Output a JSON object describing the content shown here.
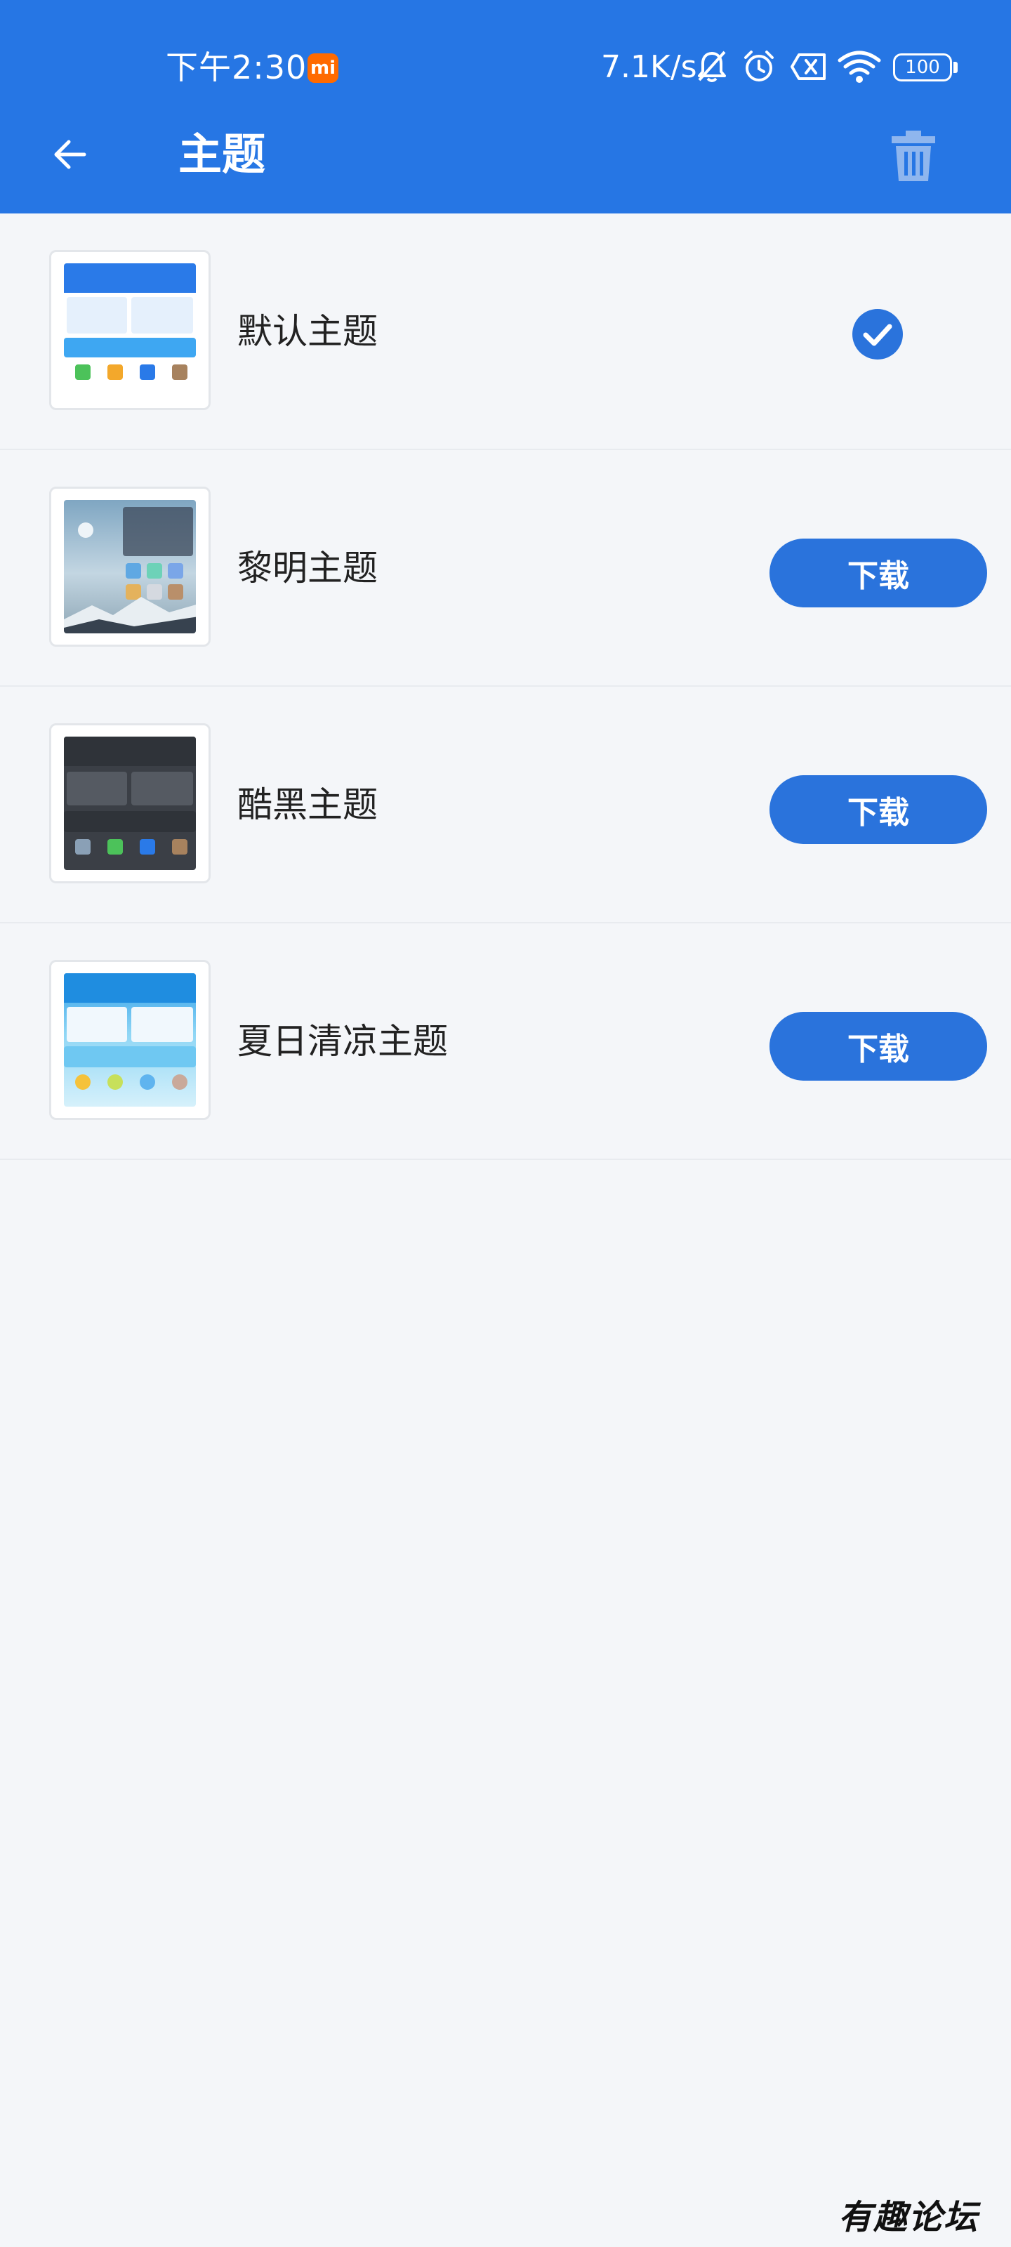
{
  "status_bar": {
    "time": "下午2:30",
    "mi_badge": "mi",
    "net_speed": "7.1K/s",
    "battery": "100"
  },
  "header": {
    "title": "主题"
  },
  "themes": [
    {
      "name": "默认主题",
      "state": "selected"
    },
    {
      "name": "黎明主题",
      "action": "下载"
    },
    {
      "name": "酷黑主题",
      "action": "下载"
    },
    {
      "name": "夏日清凉主题",
      "action": "下载"
    }
  ],
  "watermark": "有趣论坛",
  "colors": {
    "primary": "#2676e4",
    "button": "#2a73dc",
    "background": "#f4f6f9"
  }
}
